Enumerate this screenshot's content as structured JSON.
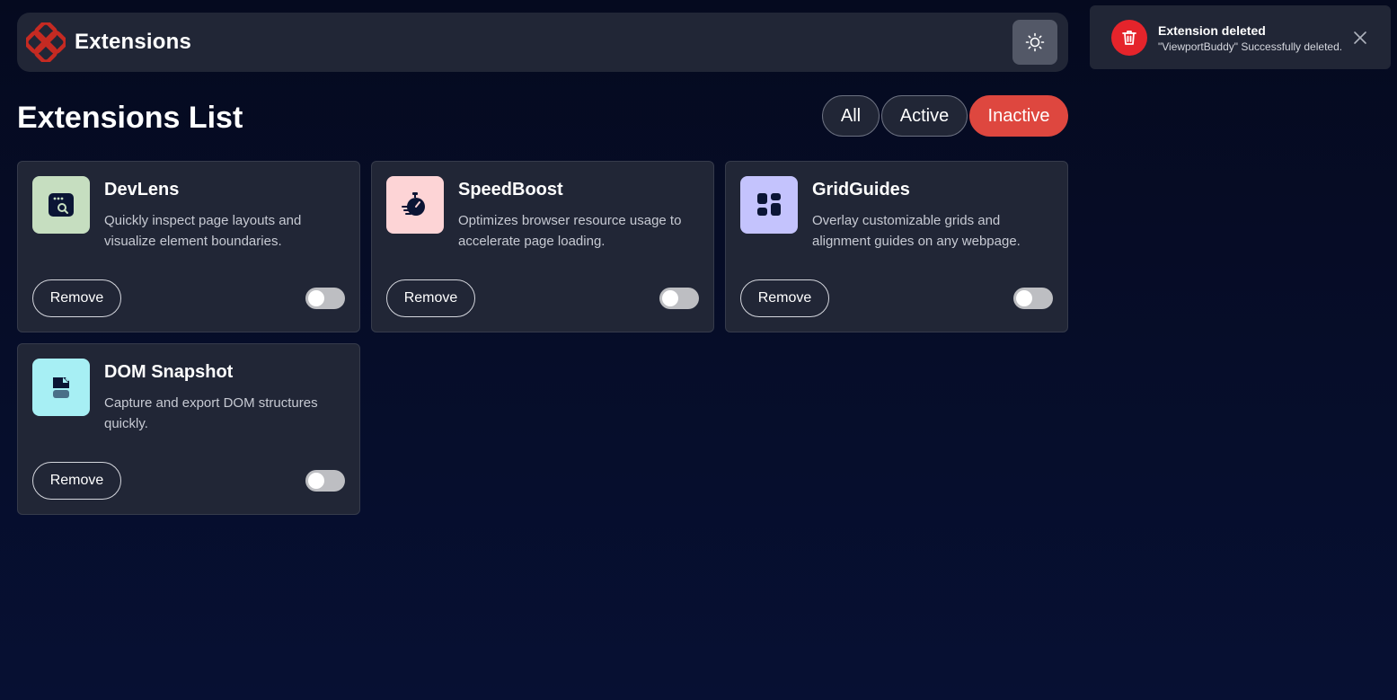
{
  "header": {
    "brand": "Extensions",
    "theme_icon": "sun-icon"
  },
  "main": {
    "title": "Extensions List",
    "filters": [
      {
        "label": "All",
        "selected": false
      },
      {
        "label": "Active",
        "selected": false
      },
      {
        "label": "Inactive",
        "selected": true
      }
    ]
  },
  "extensions": [
    {
      "name": "DevLens",
      "description": "Quickly inspect page layouts and visualize element boundaries.",
      "remove_label": "Remove",
      "icon": "devlens-icon",
      "icon_bg": "#c6dec0",
      "active": false
    },
    {
      "name": "SpeedBoost",
      "description": "Optimizes browser resource usage to accelerate page loading.",
      "remove_label": "Remove",
      "icon": "stopwatch-icon",
      "icon_bg": "#fdd4d6",
      "active": false
    },
    {
      "name": "GridGuides",
      "description": "Overlay customizable grids and alignment guides on any webpage.",
      "remove_label": "Remove",
      "icon": "grid-icon",
      "icon_bg": "#c4c3fd",
      "active": false
    },
    {
      "name": "DOM Snapshot",
      "description": "Capture and export DOM structures quickly.",
      "remove_label": "Remove",
      "icon": "snapshot-icon",
      "icon_bg": "#a7eff4",
      "active": false
    }
  ],
  "toast": {
    "title": "Extension deleted",
    "message": "\"ViewportBuddy\" Successfully deleted.",
    "icon": "trash-icon",
    "close_icon": "close-icon"
  },
  "colors": {
    "accent": "#de473f",
    "background": "#050a1f",
    "card": "#212636"
  }
}
